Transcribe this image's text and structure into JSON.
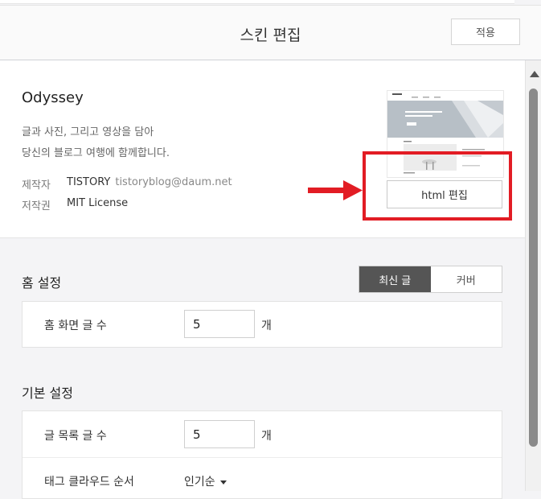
{
  "header": {
    "title": "스킨 편집",
    "apply_label": "적용"
  },
  "skin": {
    "name": "Odyssey",
    "description_line1": "글과 사진, 그리고 영상을 담아",
    "description_line2": "당신의 블로그 여행에 함께합니다.",
    "author_label": "제작자",
    "author_name": "TISTORY",
    "author_email": "tistoryblog@daum.net",
    "license_label": "저작권",
    "license_value": "MIT License",
    "html_edit_label": "html 편집"
  },
  "home_settings": {
    "title": "홈 설정",
    "toggle_options": [
      "최신 글",
      "커버"
    ],
    "selected_toggle": "최신 글",
    "post_count_label": "홈 화면 글 수",
    "post_count_value": "5",
    "unit": "개"
  },
  "basic_settings": {
    "title": "기본 설정",
    "list_count_label": "글 목록 글 수",
    "list_count_value": "5",
    "unit": "개",
    "tag_order_label": "태그 클라우드 순서",
    "tag_order_value": "인기순"
  },
  "colors": {
    "highlight": "#e21c24",
    "toggle_active": "#555555"
  },
  "icons": {
    "arrow": "arrow-right-icon",
    "caret": "caret-down-icon",
    "scroll_up": "scroll-up-icon"
  }
}
